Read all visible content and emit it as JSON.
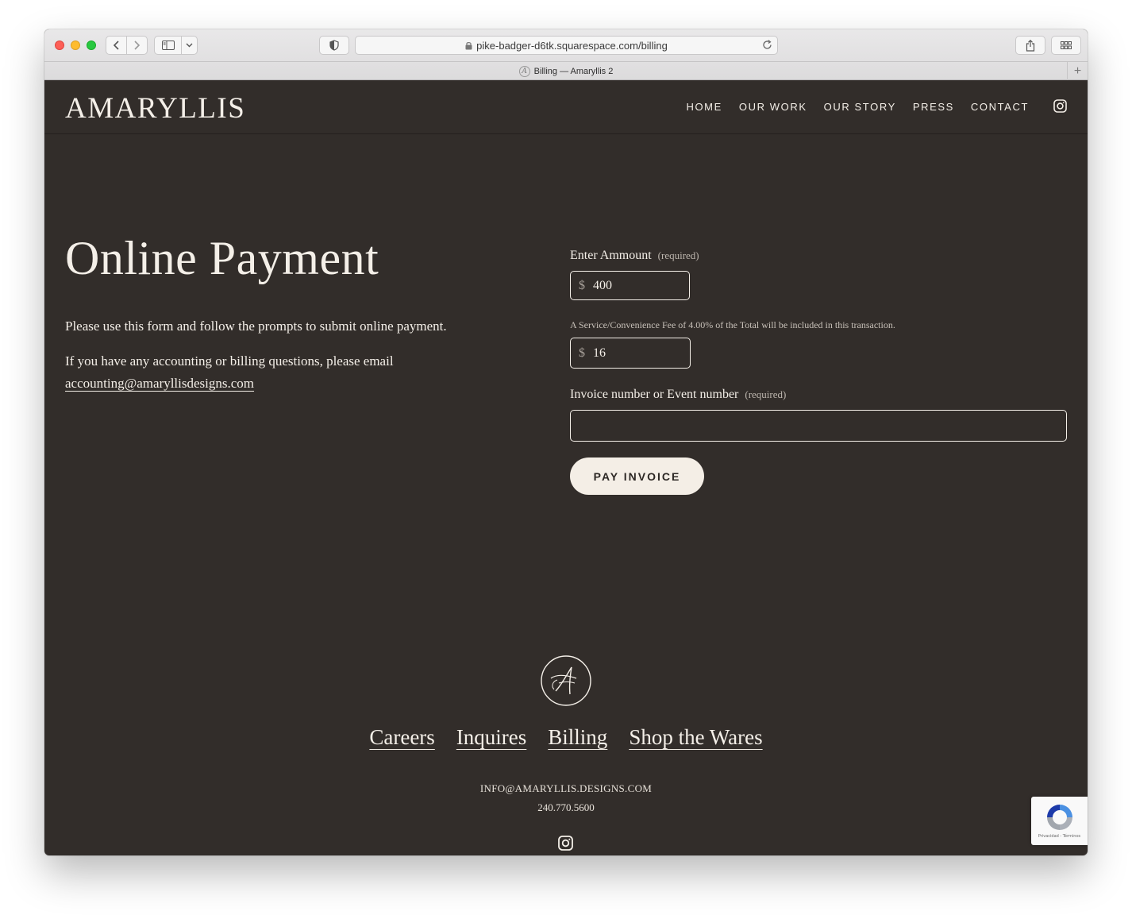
{
  "browser": {
    "url": "pike-badger-d6tk.squarespace.com/billing",
    "tab_title": "Billing — Amaryllis 2",
    "icons": [
      "back-icon",
      "forward-icon",
      "sidebar-icon",
      "chevron-down-icon",
      "shield-icon",
      "lock-icon",
      "reload-icon",
      "share-icon",
      "tabs-overview-icon",
      "new-tab-icon"
    ]
  },
  "site": {
    "logo": "AMARYLLIS",
    "nav": [
      "HOME",
      "OUR WORK",
      "OUR STORY",
      "PRESS",
      "CONTACT"
    ]
  },
  "main": {
    "headline": "Online Payment",
    "intro": "Please use this form and follow the prompts to submit online payment.",
    "contact_line": "If you have any accounting or billing questions, please email",
    "email": "accounting@amaryllisdesigns.com"
  },
  "form": {
    "amount_label": "Enter Ammount",
    "required_tag": "(required)",
    "currency": "$",
    "amount_value": "400",
    "fee_note": "A Service/Convenience Fee of 4.00% of the Total will be included in this transaction.",
    "fee_value": "16",
    "invoice_label": "Invoice number or Event number",
    "invoice_value": "",
    "submit_label": "PAY INVOICE"
  },
  "footer": {
    "links": [
      "Careers",
      "Inquires",
      "Billing",
      "Shop the Wares"
    ],
    "email": "INFO@AMARYLLIS.DESIGNS.COM",
    "phone": "240.770.5600"
  },
  "recaptcha": {
    "terms": "Privacidad - Términos"
  },
  "colors": {
    "background": "#322d2a",
    "text": "#f4efe8",
    "button_bg": "#f4eee6"
  }
}
